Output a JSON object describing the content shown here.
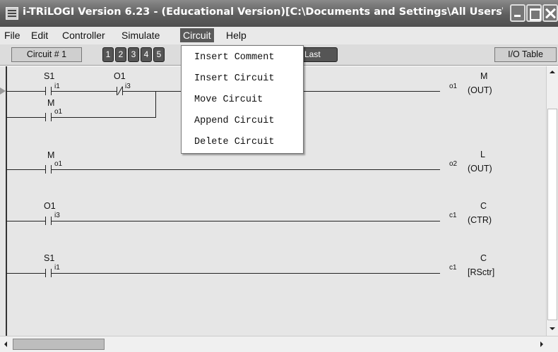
{
  "window": {
    "title": "i-TRiLOGI Version 6.23 - (Educational Version)[C:\\Documents and Settings\\All Users\\D...",
    "icon": "app-icon"
  },
  "menu": {
    "items": [
      "File",
      "Edit",
      "Controller",
      "Simulate",
      "Circuit",
      "Help"
    ],
    "active": "Circuit"
  },
  "toolbar": {
    "circuit_label": "Circuit # 1",
    "numbers": [
      "1",
      "2",
      "3",
      "4",
      "5"
    ],
    "last_label": "Last",
    "io_table_label": "I/O Table"
  },
  "circuit_menu": {
    "items": [
      "Insert Comment",
      "Insert Circuit",
      "Move Circuit",
      "Append Circuit",
      "Delete Circuit"
    ]
  },
  "rungs": [
    {
      "contacts": [
        {
          "name": "S1",
          "tag": "i1",
          "type": "NO"
        },
        {
          "name": "O1",
          "tag": "i3",
          "type": "NC"
        }
      ],
      "branch": {
        "name": "M",
        "tag": "o1",
        "type": "NO"
      },
      "coil": {
        "name": "M",
        "tag": "o1",
        "func": "(OUT)"
      }
    },
    {
      "contacts": [
        {
          "name": "M",
          "tag": "o1",
          "type": "NO"
        }
      ],
      "coil": {
        "name": "L",
        "tag": "o2",
        "func": "(OUT)"
      }
    },
    {
      "contacts": [
        {
          "name": "O1",
          "tag": "i3",
          "type": "NO"
        }
      ],
      "coil": {
        "name": "C",
        "tag": "c1",
        "func": "(CTR)"
      }
    },
    {
      "contacts": [
        {
          "name": "S1",
          "tag": "i1",
          "type": "NO"
        }
      ],
      "coil": {
        "name": "C",
        "tag": "c1",
        "func": "[RSctr]"
      }
    }
  ]
}
